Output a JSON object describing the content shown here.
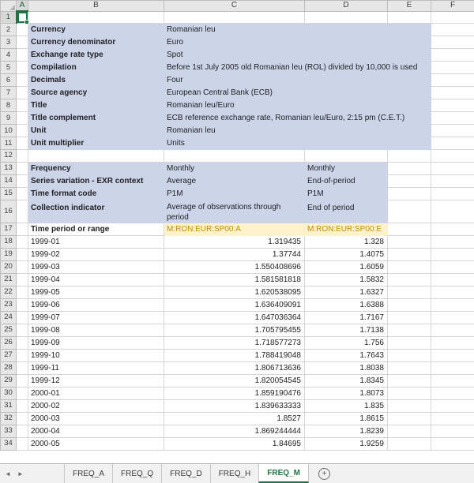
{
  "colors": {
    "band_blue": "#ccd4ea",
    "code_bg": "#fff2cc",
    "code_text": "#bf8f00",
    "accent_green": "#217346",
    "gridline": "#d6d6d6"
  },
  "columns": [
    "A",
    "B",
    "C",
    "D",
    "E",
    "F"
  ],
  "active_cell": "A1",
  "metadata_start_row": 2,
  "metadata": [
    {
      "label": "Currency",
      "value": "Romanian leu"
    },
    {
      "label": "Currency denominator",
      "value": "Euro"
    },
    {
      "label": "Exchange rate type",
      "value": "Spot"
    },
    {
      "label": "Compilation",
      "value": "Before 1st July 2005 old Romanian leu (ROL) divided by 10,000 is used"
    },
    {
      "label": "Decimals",
      "value": "Four"
    },
    {
      "label": "Source agency",
      "value": "European Central Bank (ECB)"
    },
    {
      "label": "Title",
      "value": "Romanian leu/Euro"
    },
    {
      "label": "Title complement",
      "value": "ECB reference exchange rate, Romanian leu/Euro, 2:15 pm (C.E.T.)"
    },
    {
      "label": "Unit",
      "value": "Romanian leu"
    },
    {
      "label": "Unit multiplier",
      "value": "Units"
    }
  ],
  "series_attributes_start_row": 13,
  "series_attributes": [
    {
      "label": "Frequency",
      "c": "Monthly",
      "d": "Monthly",
      "tall": false
    },
    {
      "label": "Series variation - EXR context",
      "c": "Average",
      "d": "End-of-period",
      "tall": false
    },
    {
      "label": "Time format code",
      "c": "P1M",
      "d": "P1M",
      "tall": false
    },
    {
      "label": "Collection indicator",
      "c": "Average of observations through period",
      "d": "End of period",
      "tall": true
    }
  ],
  "series_codes_row": 17,
  "series_codes": {
    "label": "Time period or range",
    "c": "M:RON:EUR:SP00:A",
    "d": "M:RON:EUR:SP00:E"
  },
  "observations_start_row": 18,
  "observations": [
    {
      "period": "1999-01",
      "c": "1.319435",
      "d": "1.328"
    },
    {
      "period": "1999-02",
      "c": "1.37744",
      "d": "1.4075"
    },
    {
      "period": "1999-03",
      "c": "1.550408696",
      "d": "1.6059"
    },
    {
      "period": "1999-04",
      "c": "1.581581818",
      "d": "1.5832"
    },
    {
      "period": "1999-05",
      "c": "1.620538095",
      "d": "1.6327"
    },
    {
      "period": "1999-06",
      "c": "1.636409091",
      "d": "1.6388"
    },
    {
      "period": "1999-07",
      "c": "1.647036364",
      "d": "1.7167"
    },
    {
      "period": "1999-08",
      "c": "1.705795455",
      "d": "1.7138"
    },
    {
      "period": "1999-09",
      "c": "1.718577273",
      "d": "1.756"
    },
    {
      "period": "1999-10",
      "c": "1.788419048",
      "d": "1.7643"
    },
    {
      "period": "1999-11",
      "c": "1.806713636",
      "d": "1.8038"
    },
    {
      "period": "1999-12",
      "c": "1.820054545",
      "d": "1.8345"
    },
    {
      "period": "2000-01",
      "c": "1.859190476",
      "d": "1.8073"
    },
    {
      "period": "2000-02",
      "c": "1.839633333",
      "d": "1.835"
    },
    {
      "period": "2000-03",
      "c": "1.8527",
      "d": "1.8615"
    },
    {
      "period": "2000-04",
      "c": "1.869244444",
      "d": "1.8239"
    },
    {
      "period": "2000-05",
      "c": "1.84695",
      "d": "1.9259"
    }
  ],
  "tabs": {
    "items": [
      "FREQ_A",
      "FREQ_Q",
      "FREQ_D",
      "FREQ_H",
      "FREQ_M"
    ],
    "active": "FREQ_M",
    "new_sheet_label": "+"
  }
}
